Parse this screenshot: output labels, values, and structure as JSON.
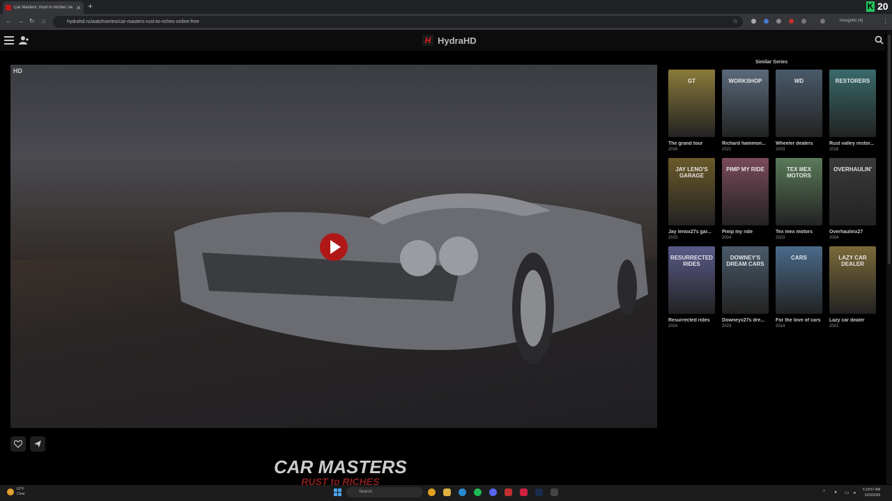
{
  "browser": {
    "tab_title": "Car Masters: Rust to Riches Se...",
    "url": "hydrahd.ru/watchseries/car-masters-rust-to-riches-online-free",
    "incognito_label": "Incognito (4)",
    "counter_badge": "20"
  },
  "site": {
    "brand_name": "HydraHD",
    "brand_logo_letter": "H"
  },
  "player": {
    "quality_badge": "HD",
    "show_title_line1": "CAR MASTERS",
    "show_title_line2": "RUST to RICHES"
  },
  "sidebar": {
    "title": "Similar Series",
    "items": [
      {
        "title": "The grand tour",
        "year": "2016",
        "poster_text": "GT",
        "color": "#8a7a3a"
      },
      {
        "title": "Richard hammon...",
        "year": "2021",
        "poster_text": "WORKSHOP",
        "color": "#5a6a7a"
      },
      {
        "title": "Wheeler dealers",
        "year": "2003",
        "poster_text": "WD",
        "color": "#4a5a6a"
      },
      {
        "title": "Rust valley restor...",
        "year": "2018",
        "poster_text": "RESTORERS",
        "color": "#3a6a6a"
      },
      {
        "title": "Jay lenox27s gar...",
        "year": "2015",
        "poster_text": "JAY LENO'S GARAGE",
        "color": "#6a5a2a"
      },
      {
        "title": "Pimp my ride",
        "year": "2004",
        "poster_text": "PIMP MY RIDE",
        "color": "#7a4a5a"
      },
      {
        "title": "Tex mex motors",
        "year": "2023",
        "poster_text": "TEX MEX MOTORS",
        "color": "#5a7a5a"
      },
      {
        "title": "Overhaulinx27",
        "year": "2004",
        "poster_text": "OVERHAULIN'",
        "color": "#3a3a3a"
      },
      {
        "title": "Resurrected rides",
        "year": "2024",
        "poster_text": "RESURRECTED RIDES",
        "color": "#5a5a8a"
      },
      {
        "title": "Downeyx27s dre...",
        "year": "2023",
        "poster_text": "DOWNEY'S DREAM CARS",
        "color": "#4a5a6a"
      },
      {
        "title": "For the love of cars",
        "year": "2014",
        "poster_text": "CARS",
        "color": "#4a6a8a"
      },
      {
        "title": "Lazy car dealer",
        "year": "2021",
        "poster_text": "LAZY CAR DEALER",
        "color": "#7a6a3a"
      }
    ]
  },
  "taskbar": {
    "weather_temp": "62°F",
    "weather_cond": "Clear",
    "search_placeholder": "Search",
    "time": "5:18:57 AM",
    "date": "5/23/2025"
  }
}
